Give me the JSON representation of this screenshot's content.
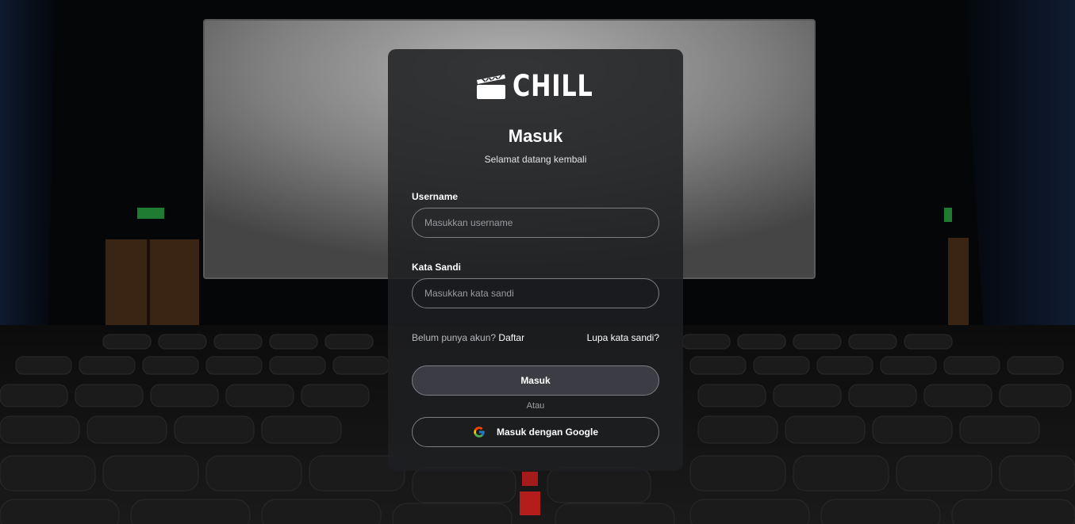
{
  "brand": {
    "logo_text": "CHILL",
    "logo_icon": "clapperboard-icon"
  },
  "login": {
    "title": "Masuk",
    "subtitle": "Selamat datang kembali",
    "username": {
      "label": "Username",
      "placeholder": "Masukkan username",
      "value": ""
    },
    "password": {
      "label": "Kata Sandi",
      "placeholder": "Masukkan kata sandi",
      "value": ""
    },
    "no_account_text": "Belum punya akun?",
    "register_link": "Daftar",
    "forgot_link": "Lupa kata sandi?",
    "submit_label": "Masuk",
    "divider_text": "Atau",
    "google_label": "Masuk dengan Google",
    "google_icon": "google-icon"
  },
  "colors": {
    "card_bg": "#1e1f22",
    "button_bg": "#3c3c44",
    "border": "#7d7e82"
  }
}
